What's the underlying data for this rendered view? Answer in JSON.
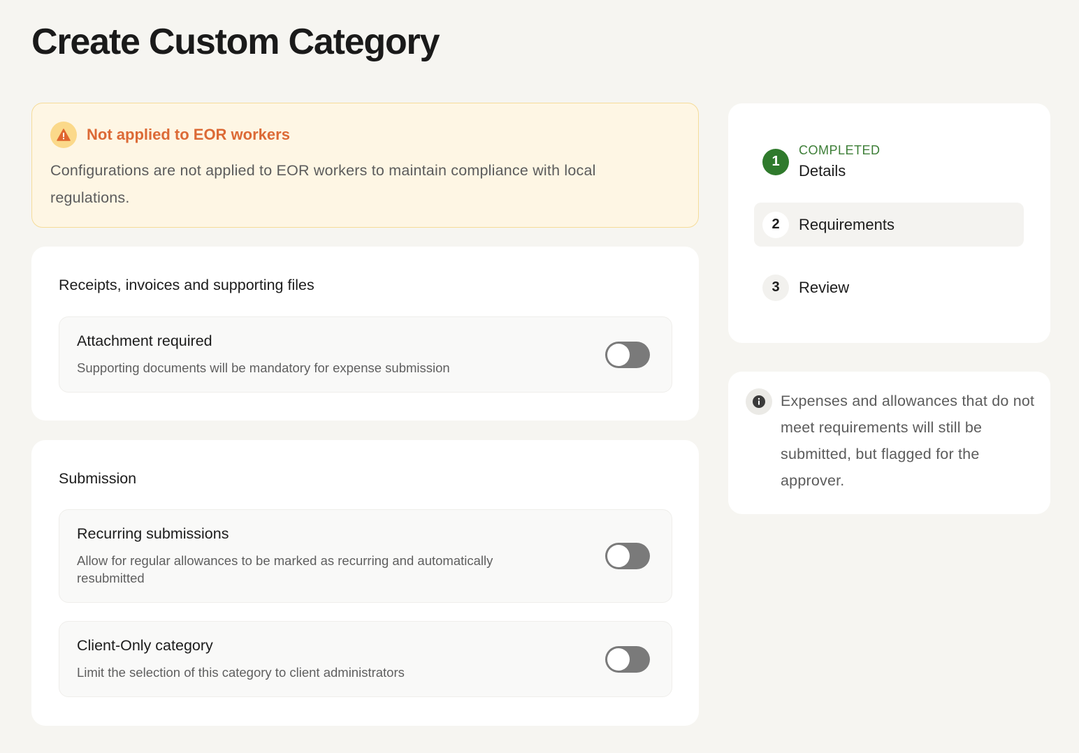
{
  "page": {
    "title": "Create Custom Category"
  },
  "warning": {
    "icon": "warning-triangle-icon",
    "title": "Not applied to EOR workers",
    "text": "Configurations are not applied to EOR workers to maintain compliance with local regulations.",
    "accent": "#dc6a36"
  },
  "sections": {
    "receipts": {
      "title": "Receipts, invoices and supporting files",
      "settings": [
        {
          "title": "Attachment required",
          "description": "Supporting documents will be mandatory for expense submission",
          "enabled": false
        }
      ]
    },
    "submission": {
      "title": "Submission",
      "settings": [
        {
          "title": "Recurring submissions",
          "description": "Allow for regular allowances to be marked as recurring and automatically resubmitted",
          "enabled": false
        },
        {
          "title": "Client-Only category",
          "description": "Limit the selection of this category to client administrators",
          "enabled": false
        }
      ]
    }
  },
  "steps": [
    {
      "number": "1",
      "status": "COMPLETED",
      "label": "Details",
      "state": "completed"
    },
    {
      "number": "2",
      "status": "",
      "label": "Requirements",
      "state": "active"
    },
    {
      "number": "3",
      "status": "",
      "label": "Review",
      "state": "pending"
    }
  ],
  "info": {
    "icon": "info-icon",
    "text": "Expenses and allowances that do not meet requirements will still be submitted, but flagged for the approver."
  },
  "colors": {
    "background": "#f6f5f1",
    "completed_green": "#2f7a2c",
    "toggle_off": "#7a7a7a",
    "warning_bg": "#fef6e4"
  }
}
